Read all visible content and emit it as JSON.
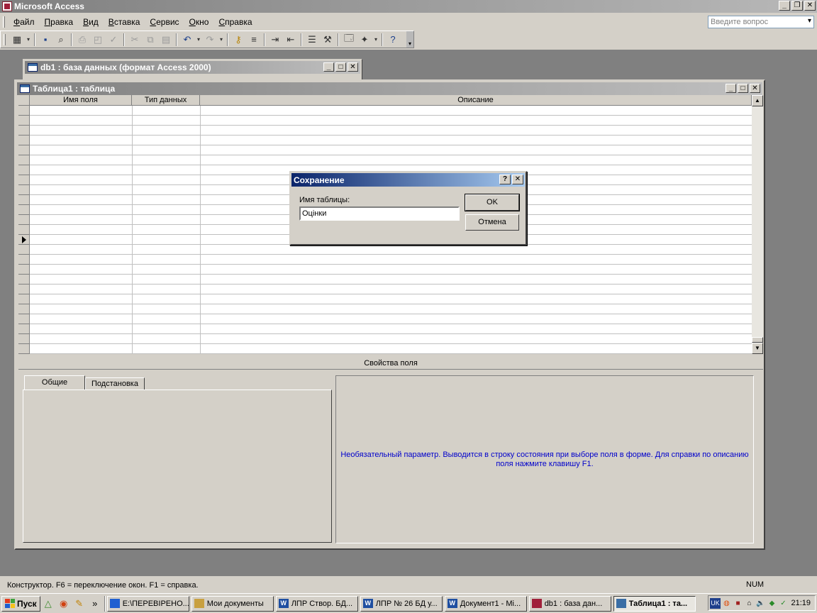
{
  "app": {
    "title": "Microsoft Access"
  },
  "menu": [
    "Файл",
    "Правка",
    "Вид",
    "Вставка",
    "Сервис",
    "Окно",
    "Справка"
  ],
  "ask_placeholder": "Введите вопрос",
  "db_window": {
    "title": "db1 : база данных (формат Access 2000)"
  },
  "table_window": {
    "title": "Таблица1 : таблица",
    "columns": [
      "Имя поля",
      "Тип данных",
      "Описание"
    ]
  },
  "field_properties": {
    "label": "Свойства поля",
    "tabs": [
      "Общие",
      "Подстановка"
    ],
    "help_text": "Необязательный параметр.  Выводится в строку состояния при выборе поля в форме.  Для справки по описанию поля нажмите клавишу F1."
  },
  "dialog": {
    "title": "Сохранение",
    "label": "Имя таблицы:",
    "value": "Оцінки",
    "ok": "OK",
    "cancel": "Отмена"
  },
  "status": {
    "text": "Конструктор.  F6 = переключение окон.  F1 = справка.",
    "num": "NUM"
  },
  "taskbar": {
    "start": "Пуск",
    "tasks": [
      "E:\\ПЕРЕВІРЕНО...",
      "Мои документы",
      "ЛПР Створ. БД...",
      "ЛПР № 26 БД у...",
      "Документ1 - Mi...",
      "db1 : база дан...",
      "Таблица1 : та..."
    ],
    "lang": "UK",
    "clock": "21:19"
  }
}
